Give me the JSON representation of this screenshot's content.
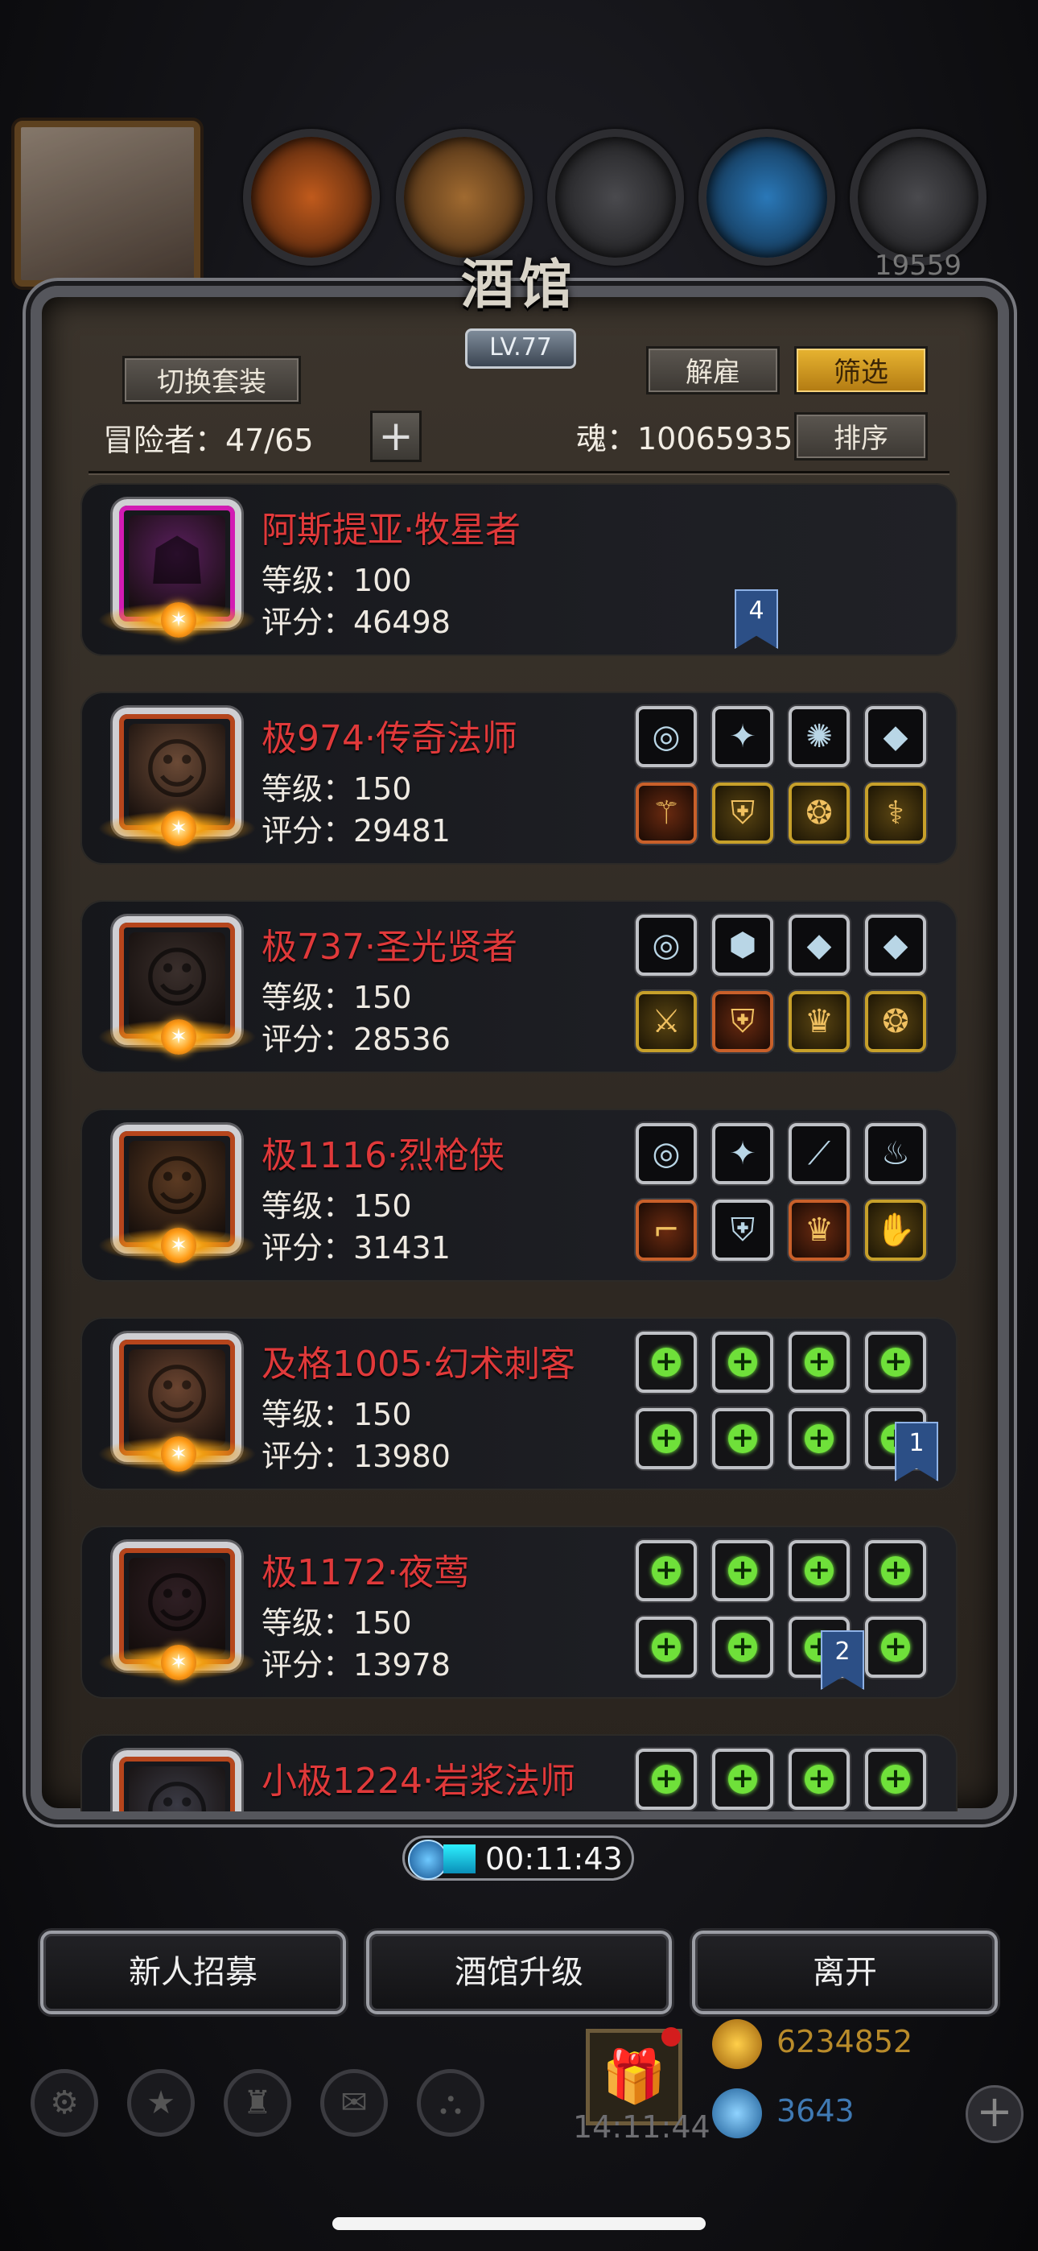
{
  "header": {
    "title": "酒馆",
    "level": "LV.77",
    "switch_set_label": "切换套装",
    "fire_label": "解雇",
    "filter_label": "筛选",
    "sort_label": "排序",
    "adventurers": "冒险者：47/65",
    "soul": "魂：10065935"
  },
  "heroes": [
    {
      "name": "阿斯提亚·牧星者",
      "level": "等级：100",
      "score": "评分：46498",
      "rarity": "epic",
      "gear": null
    },
    {
      "name": "极974·传奇法师",
      "level": "等级：150",
      "score": "评分：29481",
      "rarity": "legend",
      "gear": [
        {
          "icon": "ring-icon",
          "glyph": "◎",
          "tier": "silver"
        },
        {
          "icon": "crystal-icon",
          "glyph": "✦",
          "tier": "silver"
        },
        {
          "icon": "coral-icon",
          "glyph": "✺",
          "tier": "silver"
        },
        {
          "icon": "gem-icon",
          "glyph": "◆",
          "tier": "silver"
        },
        {
          "icon": "staff-icon",
          "glyph": "⚚",
          "tier": "orange"
        },
        {
          "icon": "armor-icon",
          "glyph": "⛨",
          "tier": "gold"
        },
        {
          "icon": "amulet-icon",
          "glyph": "❂",
          "tier": "gold"
        },
        {
          "icon": "wand-icon",
          "glyph": "⚕",
          "tier": "gold"
        }
      ]
    },
    {
      "name": "极737·圣光贤者",
      "level": "等级：150",
      "score": "评分：28536",
      "rarity": "legend",
      "gear": [
        {
          "icon": "ring-icon",
          "glyph": "◎",
          "tier": "silver"
        },
        {
          "icon": "stone-icon",
          "glyph": "⬢",
          "tier": "silver"
        },
        {
          "icon": "purple-gem-icon",
          "glyph": "◆",
          "tier": "silver"
        },
        {
          "icon": "gem-icon",
          "glyph": "◆",
          "tier": "silver"
        },
        {
          "icon": "spear-icon",
          "glyph": "⚔",
          "tier": "gold"
        },
        {
          "icon": "armor-icon",
          "glyph": "⛨",
          "tier": "orange"
        },
        {
          "icon": "crown-icon",
          "glyph": "♛",
          "tier": "gold"
        },
        {
          "icon": "charm-icon",
          "glyph": "❂",
          "tier": "gold"
        }
      ]
    },
    {
      "name": "极1116·烈枪侠",
      "level": "等级：150",
      "score": "评分：31431",
      "rarity": "legend",
      "gear": [
        {
          "icon": "ring-icon",
          "glyph": "◎",
          "tier": "silver"
        },
        {
          "icon": "crystal-icon",
          "glyph": "✦",
          "tier": "silver"
        },
        {
          "icon": "blade-icon",
          "glyph": "⟋",
          "tier": "silver"
        },
        {
          "icon": "lantern-icon",
          "glyph": "♨",
          "tier": "silver"
        },
        {
          "icon": "pistol-icon",
          "glyph": "⌐",
          "tier": "orange"
        },
        {
          "icon": "armor-icon",
          "glyph": "⛨",
          "tier": "silver"
        },
        {
          "icon": "crown-icon",
          "glyph": "♛",
          "tier": "orange"
        },
        {
          "icon": "gauntlet-icon",
          "glyph": "✋",
          "tier": "gold"
        }
      ]
    },
    {
      "name": "及格1005·幻术刺客",
      "level": "等级：150",
      "score": "评分：13980",
      "rarity": "legend",
      "gear": "empty"
    },
    {
      "name": "极1172·夜莺",
      "level": "等级：150",
      "score": "评分：13978",
      "rarity": "legend",
      "gear": "empty"
    },
    {
      "name": "小极1224·岩浆法师",
      "level": "",
      "score": "",
      "rarity": "legend",
      "gear": "empty"
    }
  ],
  "bookmarks": [
    "4",
    "1",
    "2"
  ],
  "timer": "00:11:43",
  "bottom_buttons": {
    "recruit": "新人招募",
    "upgrade": "酒馆升级",
    "leave": "离开"
  },
  "hud": {
    "gold": "6234852",
    "gems": "3643",
    "gift_time": "14:11:44",
    "res_top": [
      "",
      "",
      "",
      "",
      "",
      "19559"
    ]
  },
  "colors": {
    "accent_gold": "#e8b431",
    "hero_name": "#e0393a",
    "slot_plus": "#6fe03a"
  }
}
